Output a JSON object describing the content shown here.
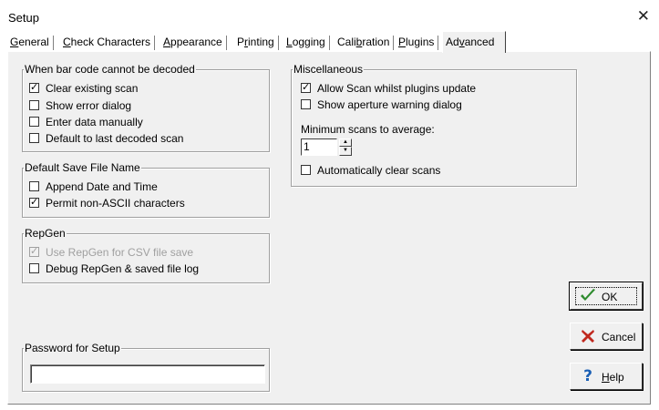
{
  "window": {
    "title": "Setup",
    "close_glyph": "✕"
  },
  "tabs": [
    {
      "label": "General",
      "mnemonic": "G"
    },
    {
      "label": "Check Characters",
      "mnemonic": "C"
    },
    {
      "label": "Appearance",
      "mnemonic": "A"
    },
    {
      "label": "Printing",
      "mnemonic": "r"
    },
    {
      "label": "Logging",
      "mnemonic": "L"
    },
    {
      "label": "Calibration",
      "mnemonic": "b"
    },
    {
      "label": "Plugins",
      "mnemonic": "P"
    },
    {
      "label": "Advanced",
      "mnemonic": "v",
      "active": true
    }
  ],
  "decode_group": {
    "legend": "When bar code cannot be decoded",
    "options": [
      {
        "label": "Clear existing scan",
        "checked": true
      },
      {
        "label": "Show error dialog",
        "checked": false
      },
      {
        "label": "Enter data manually",
        "checked": false
      },
      {
        "label": "Default to last decoded scan",
        "checked": false
      }
    ]
  },
  "filename_group": {
    "legend": "Default Save File Name",
    "options": [
      {
        "label": "Append Date and Time",
        "checked": false
      },
      {
        "label": "Permit non-ASCII characters",
        "checked": true
      }
    ]
  },
  "repgen_group": {
    "legend": "RepGen",
    "options": [
      {
        "label": "Use RepGen for CSV file save",
        "checked": true,
        "disabled": true
      },
      {
        "label": "Debug RepGen & saved file log",
        "checked": false
      }
    ]
  },
  "password_group": {
    "legend": "Password for Setup",
    "value": ""
  },
  "misc_group": {
    "legend": "Miscellaneous",
    "options": [
      {
        "label": "Allow Scan whilst plugins update",
        "checked": true
      },
      {
        "label": "Show aperture warning dialog",
        "checked": false
      }
    ],
    "min_scans_label": "Minimum scans to average:",
    "min_scans_value": "1",
    "auto_clear": {
      "label": "Automatically clear scans",
      "checked": false
    }
  },
  "buttons": {
    "ok": {
      "label": "OK",
      "icon": "checkmark-icon",
      "color": "#2e8b2e"
    },
    "cancel": {
      "label": "Cancel",
      "icon": "x-icon",
      "color": "#c0281e"
    },
    "help": {
      "label": "Help",
      "mnemonic": "H",
      "icon": "question-icon",
      "color": "#1a5fb4"
    }
  }
}
